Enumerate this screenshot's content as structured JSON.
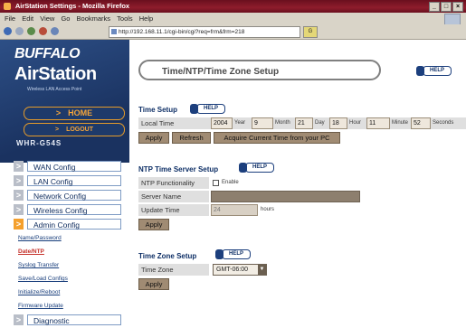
{
  "window": {
    "title": "AirStation Settings - Mozilla Firefox",
    "controls": [
      "_",
      "□",
      "×"
    ]
  },
  "menubar": {
    "items": [
      "File",
      "Edit",
      "View",
      "Go",
      "Bookmarks",
      "Tools",
      "Help"
    ]
  },
  "toolbar": {
    "url": "http://192.168.11.1/cgi-bin/cgi?req=frm&frm=218"
  },
  "sidebar": {
    "brand": "BUFFALO",
    "product": "AirStation",
    "tagline": "Wireless LAN Access Point",
    "home_label": "HOME",
    "logout_label": "LOGOUT",
    "model": "WHR-G54S",
    "menu": [
      {
        "label": "WAN Config"
      },
      {
        "label": "LAN Config"
      },
      {
        "label": "Network Config"
      },
      {
        "label": "Wireless Config"
      },
      {
        "label": "Admin Config"
      }
    ],
    "submenu": [
      {
        "label": "Name/Password"
      },
      {
        "label": "Date/NTP"
      },
      {
        "label": "Syslog Transfer"
      },
      {
        "label": "Save/Load Configs"
      },
      {
        "label": "Initialize/Reboot"
      },
      {
        "label": "Firmware Update"
      }
    ],
    "diagnostic": "Diagnostic"
  },
  "main": {
    "page_title": "Time/NTP/Time Zone Setup",
    "help_label": "HELP",
    "time_setup": {
      "title": "Time Setup",
      "local_time_label": "Local Time",
      "year_value": "2004",
      "year_unit": "Year",
      "month_value": "9",
      "month_unit": "Month",
      "day_value": "21",
      "day_unit": "Day",
      "hour_value": "18",
      "hour_unit": "Hour",
      "minute_value": "11",
      "minute_unit": "Minute",
      "second_value": "52",
      "second_unit": "Seconds",
      "apply": "Apply",
      "refresh": "Refresh",
      "acquire": "Acquire Current Time from your PC"
    },
    "ntp": {
      "title": "NTP Time Server Setup",
      "functionality_label": "NTP Functionality",
      "enable_label": "Enable",
      "server_label": "Server Name",
      "update_label": "Update Time",
      "update_value": "24",
      "update_unit": "hours",
      "apply": "Apply"
    },
    "timezone": {
      "title": "Time Zone Setup",
      "label": "Time Zone",
      "value": "GMT-06:00",
      "apply": "Apply"
    }
  }
}
